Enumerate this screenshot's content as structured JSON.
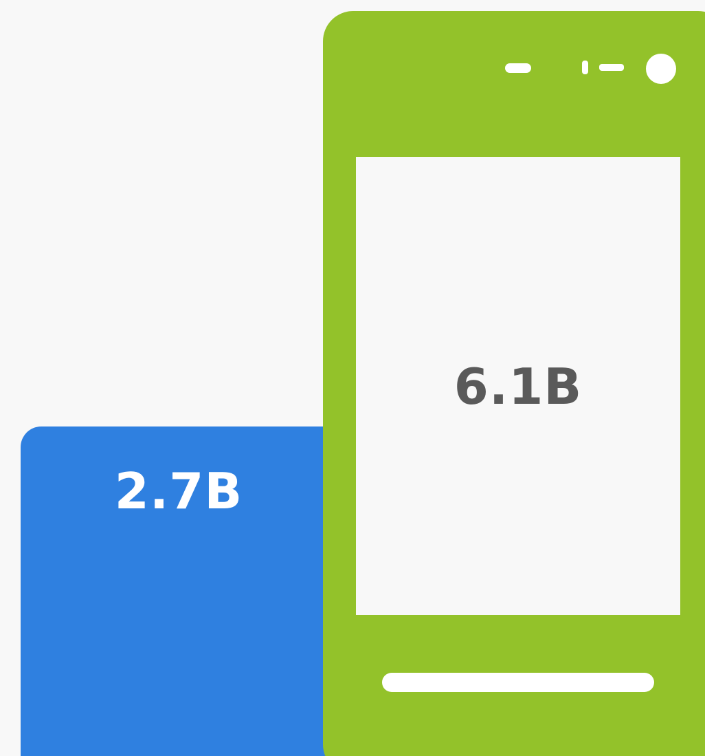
{
  "blue_block": {
    "value": "2.7B",
    "color": "#2f80e0"
  },
  "phone": {
    "value": "6.1B",
    "color": "#93c22a"
  }
}
